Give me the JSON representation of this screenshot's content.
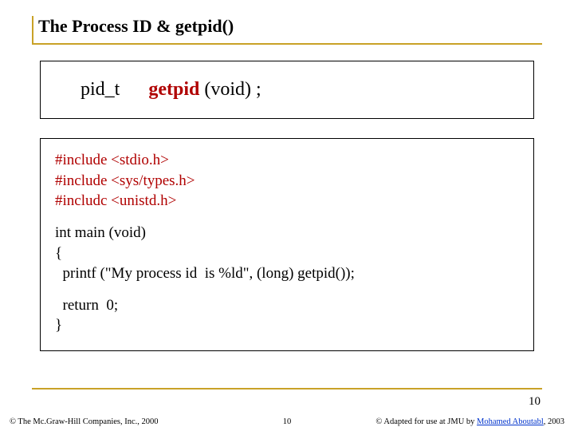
{
  "title": "The Process ID & getpid()",
  "signature": {
    "return_type": "pid_t",
    "func_name": "getpid",
    "args": "(void) ;"
  },
  "code": {
    "inc1": "#include <stdio.h>",
    "inc2": "#include <sys/types.h>",
    "inc3": "#includc <unistd.h>",
    "decl": "int main (void)",
    "brace_open": "{",
    "body1": "  printf (\"My process id  is %ld\", (long) getpid());",
    "ret": "  return  0;",
    "brace_close": "}"
  },
  "page_number_large": "10",
  "footer": {
    "left": "© The Mc.Graw-Hill Companies, Inc., 2000",
    "center": "10",
    "right_prefix": "© Adapted for use at JMU by ",
    "right_link": "Mohamed Aboutabl",
    "right_suffix": ", 2003"
  }
}
